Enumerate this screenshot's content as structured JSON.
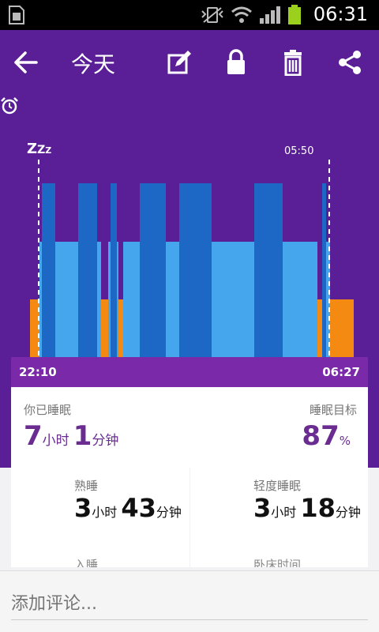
{
  "status_bar": {
    "time": "06:31",
    "icons": [
      "sim-icon",
      "vibrate-icon",
      "wifi-icon",
      "signal-icon",
      "battery-icon"
    ]
  },
  "app_bar": {
    "title": "今天",
    "actions": [
      "edit-icon",
      "lock-icon",
      "delete-icon",
      "share-icon"
    ]
  },
  "sleep_chart": {
    "sleep_marker": "zzz",
    "wake_time_label": "05:50",
    "start_time": "22:10",
    "end_time": "06:27",
    "colors": {
      "awake": "#f58a12",
      "light": "#45a6ee",
      "deep": "#1d68c5",
      "background": "#5a1e96",
      "time_bar": "#7a2aa8"
    }
  },
  "summary": {
    "slept_label": "你已睡眠",
    "hours": "7",
    "hours_unit": "小时",
    "minutes": "1",
    "minutes_unit": "分钟",
    "goal_label": "睡眠目标",
    "goal_percent": "87",
    "goal_unit": "%"
  },
  "stats": [
    {
      "title": "熟睡",
      "hours": "3",
      "hours_unit": "小时",
      "minutes": "43",
      "minutes_unit": "分钟",
      "sub_label": "入睡",
      "moon_color": "#1d68c5"
    },
    {
      "title": "轻度睡眠",
      "hours": "3",
      "hours_unit": "小时",
      "minutes": "18",
      "minutes_unit": "分钟",
      "sub_label": "卧床时间",
      "moon_color": "#45a6ee"
    }
  ],
  "comment": {
    "placeholder": "添加评论..."
  }
}
